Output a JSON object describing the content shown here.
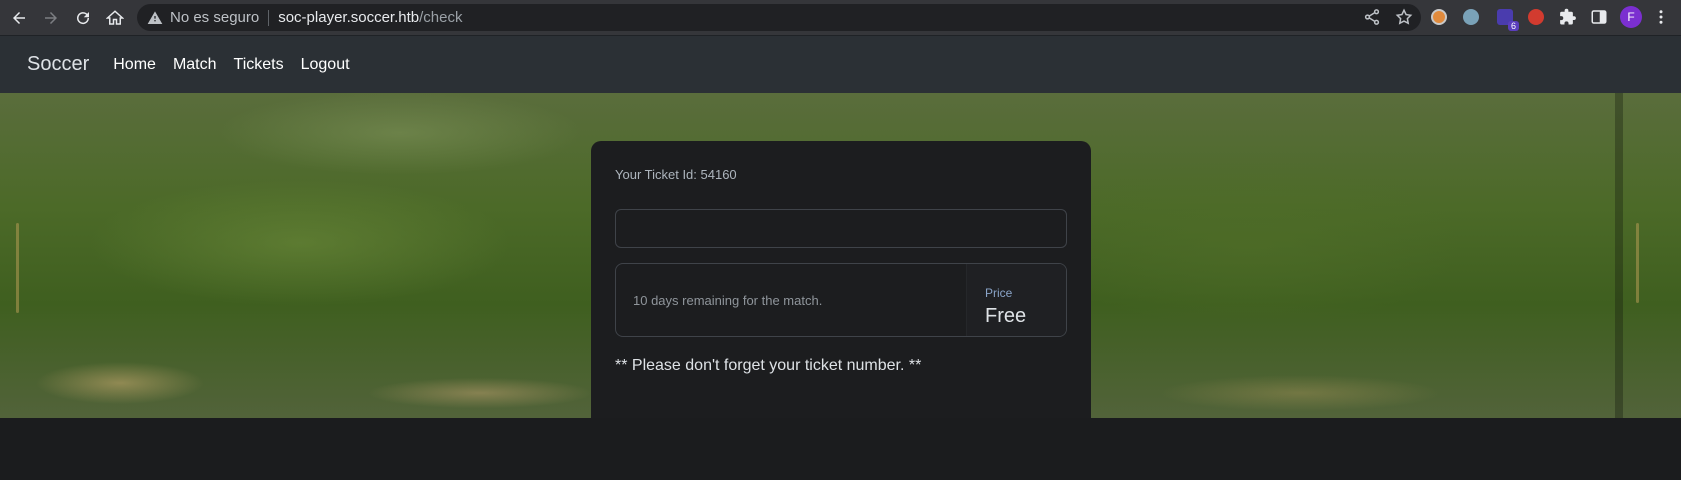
{
  "browser": {
    "security_label": "No es seguro",
    "host": "soc-player.soccer.htb",
    "path": "/check",
    "extension_badge": "6",
    "profile_initial": "F"
  },
  "navbar": {
    "brand": "Soccer",
    "links": [
      "Home",
      "Match",
      "Tickets",
      "Logout"
    ]
  },
  "card": {
    "ticket_id_text": "Your Ticket Id: 54160",
    "input_value": "",
    "remaining_text": "10 days remaining for the match.",
    "price_label": "Price",
    "price_value": "Free",
    "note": "** Please don't forget your ticket number. **"
  },
  "colors": {
    "page_bg": "#1b1c1e",
    "navbar_bg": "#2b3035",
    "card_bg": "#1c1d1f",
    "price_label": "#8aa4c8"
  }
}
